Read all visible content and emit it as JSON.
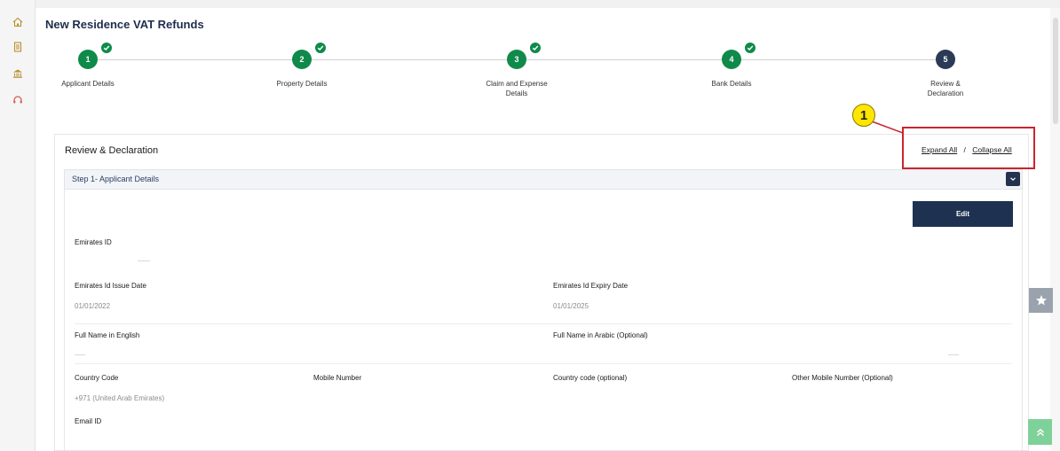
{
  "header": {
    "title": "New Residence VAT Refunds"
  },
  "sidebar": {
    "icons": [
      "home-icon",
      "document-icon",
      "bank-icon",
      "headset-icon"
    ]
  },
  "stepper": {
    "steps": [
      {
        "num": "1",
        "label": "Applicant Details",
        "status": "done"
      },
      {
        "num": "2",
        "label": "Property Details",
        "status": "done"
      },
      {
        "num": "3",
        "label": "Claim and Expense Details",
        "status": "done"
      },
      {
        "num": "4",
        "label": "Bank Details",
        "status": "done"
      },
      {
        "num": "5",
        "label": "Review & Declaration",
        "status": "current"
      }
    ]
  },
  "annotation": {
    "marker": "1"
  },
  "review": {
    "title": "Review & Declaration",
    "expand_all": "Expand All",
    "separator": "/",
    "collapse_all": "Collapse All"
  },
  "section1": {
    "title": "Step 1- Applicant Details",
    "edit_label": "Edit",
    "fields": {
      "emirates_id": {
        "label": "Emirates ID",
        "value": ""
      },
      "issue_date": {
        "label": "Emirates Id Issue Date",
        "value": "01/01/2022"
      },
      "expiry_date": {
        "label": "Emirates Id Expiry Date",
        "value": "01/01/2025"
      },
      "name_en": {
        "label": "Full Name in English",
        "value": ""
      },
      "name_ar": {
        "label": "Full Name in Arabic (Optional)",
        "value": ""
      },
      "country_code": {
        "label": "Country Code",
        "value": "+971 (United Arab Emirates)"
      },
      "mobile": {
        "label": "Mobile Number",
        "value": ""
      },
      "country_code_opt": {
        "label": "Country code (optional)",
        "value": ""
      },
      "other_mobile": {
        "label": "Other Mobile Number (Optional)",
        "value": ""
      },
      "email": {
        "label": "Email ID",
        "value": ""
      }
    }
  },
  "colors": {
    "step_done": "#0f8a4a",
    "step_current": "#2b3a55",
    "primary_button": "#1f3150",
    "annotation_box": "#c9252c",
    "annotation_marker": "#ffe600"
  }
}
